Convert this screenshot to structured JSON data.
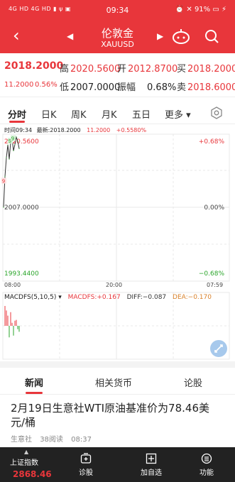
{
  "status": {
    "left": "4G HD 4G HD ▮ ψ ▣",
    "time": "09:34",
    "battery": "⏰ ✕ 91% ▭ ⚡"
  },
  "header": {
    "back": "‹",
    "title": "伦敦金",
    "subtitle": "XAUUSD",
    "prev": "◀",
    "next": "▶"
  },
  "quote": {
    "price": "2018.2000",
    "change": "11.2000",
    "change_pct": "0.56%",
    "high_label": "高",
    "high": "2020.5600",
    "open_label": "开",
    "open": "2012.8700",
    "buy_label": "买",
    "buy": "2018.2000",
    "low_label": "低",
    "low": "2007.0000",
    "amplitude_label": "振幅",
    "amplitude": "0.68%",
    "sell_label": "卖",
    "sell": "2018.6000"
  },
  "tabs": [
    "分时",
    "日K",
    "周K",
    "月K",
    "五日",
    "更多 ▾"
  ],
  "chart_info": {
    "time": "时间09:34",
    "latest": "最新:2018.2000",
    "change": "11.2000",
    "pct": "+0.5580%"
  },
  "chart_data": {
    "type": "line",
    "title": "",
    "y_left_labels": [
      "2020.5600",
      "2007.0000",
      "1993.4400"
    ],
    "y_right_labels": [
      "+0.68%",
      "0.00%",
      "−0.68%"
    ],
    "x_labels": [
      "08:00",
      "20:00",
      "07:59"
    ],
    "ylim": [
      1993.44,
      2020.56
    ],
    "series": [
      {
        "values": [
          2007.0,
          2012.9,
          2016.5,
          2018.9,
          2016.2,
          2019.4,
          2020.1,
          2017.8,
          2019.0,
          2020.4,
          2019.6,
          2018.2
        ]
      }
    ],
    "markers": [
      "9",
      "9",
      "9"
    ]
  },
  "macd": {
    "label": "MACDFS(5,10,5) ▾",
    "macdfs": "MACDFS:+0.167",
    "diff": "DIFF:−0.087",
    "dea": "DEA:−0.170"
  },
  "news_tabs": [
    "新闻",
    "相关货币",
    "论股"
  ],
  "news": {
    "title": "2月19日生意社WTI原油基准价为78.46美元/桶",
    "source": "生意社",
    "reads": "38阅读",
    "time": "08:37"
  },
  "bottom": {
    "index_label": "上证指数",
    "index_value": "2868.46",
    "caret": "▲",
    "items": [
      "诊股",
      "加自选",
      "功能"
    ]
  },
  "colors": {
    "brand_red": "#e8363b",
    "green": "#2aa52a"
  }
}
